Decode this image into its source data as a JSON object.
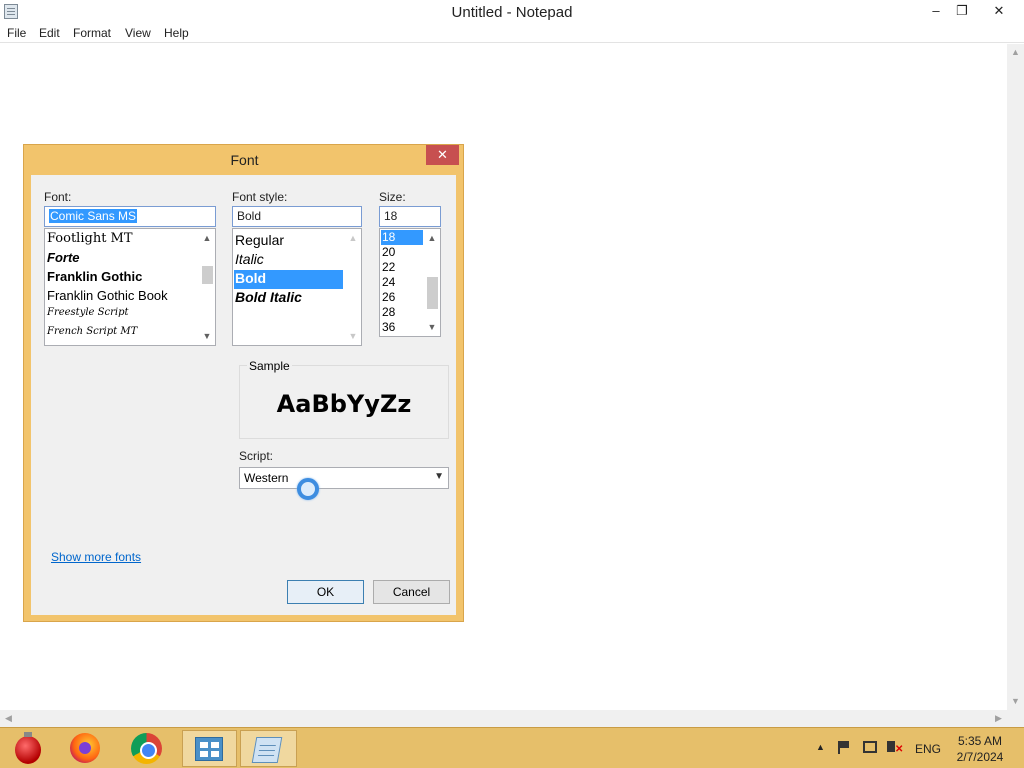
{
  "notepad": {
    "title": "Untitled - Notepad",
    "controls": {
      "minimize": "–",
      "maximize": "❐",
      "close": "✕"
    },
    "menu": [
      "File",
      "Edit",
      "Format",
      "View",
      "Help"
    ]
  },
  "font_dialog": {
    "title": "Font",
    "close": "✕",
    "font_label": "Font:",
    "font_value": "Comic Sans MS",
    "font_list": [
      "Footlight MT",
      "Forte",
      "Franklin Gothic",
      "Franklin Gothic Book",
      "Freestyle Script",
      "French Script MT"
    ],
    "style_label": "Font style:",
    "style_value": "Bold",
    "style_list": [
      "Regular",
      "Italic",
      "Bold",
      "Bold Italic"
    ],
    "style_selected": "Bold",
    "size_label": "Size:",
    "size_value": "18",
    "size_list": [
      "18",
      "20",
      "22",
      "24",
      "26",
      "28",
      "36"
    ],
    "size_selected": "18",
    "sample_label": "Sample",
    "sample_text": "AaBbYyZz",
    "script_label": "Script:",
    "script_value": "Western",
    "show_more_link": "Show more fonts",
    "ok_label": "OK",
    "cancel_label": "Cancel"
  },
  "taskbar": {
    "apps": [
      "ornament-icon",
      "firefox-icon",
      "chrome-icon",
      "control-panel-icon",
      "notepad-icon"
    ],
    "active_app": "notepad-icon",
    "language": "ENG",
    "time": "5:35 AM",
    "date": "2/7/2024"
  },
  "colors": {
    "dialog_frame": "#f2c46c",
    "selection": "#3399ff",
    "close_button": "#c75050",
    "taskbar": "#e6bf6a"
  }
}
